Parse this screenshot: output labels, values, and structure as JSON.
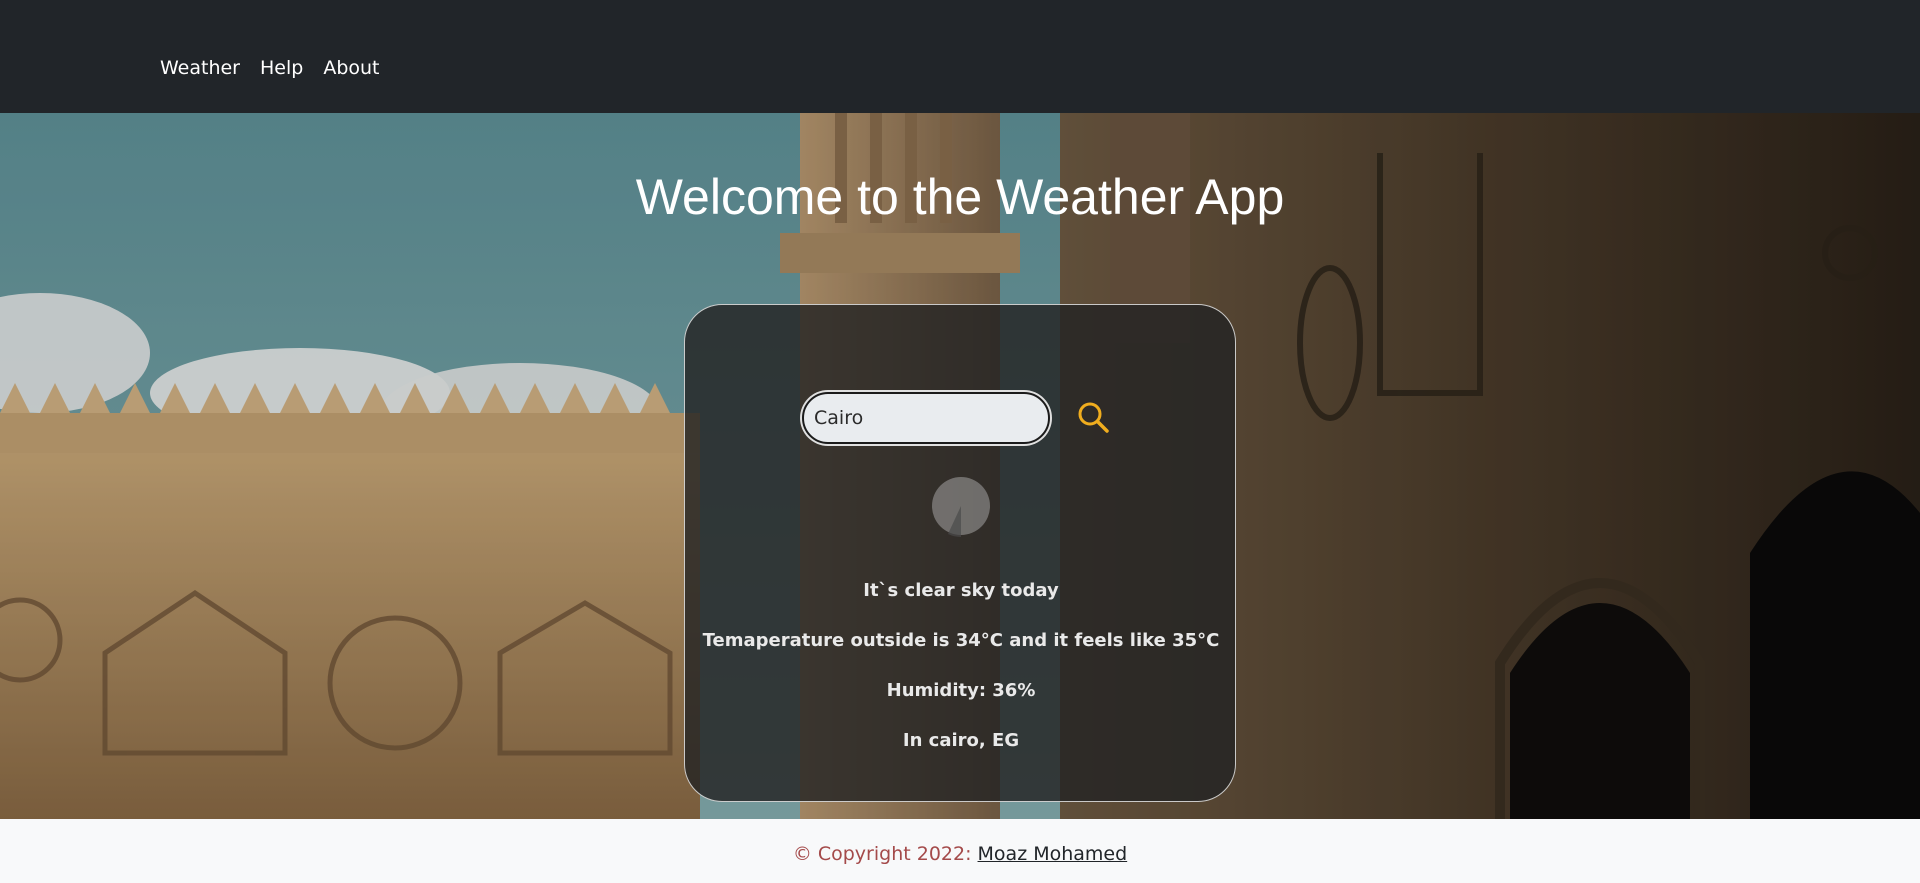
{
  "nav": {
    "items": [
      {
        "label": "Weather"
      },
      {
        "label": "Help"
      },
      {
        "label": "About"
      }
    ]
  },
  "hero": {
    "title": "Welcome to the Weather App"
  },
  "search": {
    "value": "Cairo",
    "button_icon": "search-icon"
  },
  "weather": {
    "icon": "weather-cloud-icon",
    "description": "It`s clear sky today",
    "temperature": "Temaperature outside is 34°C and it feels like 35°C",
    "humidity": "Humidity: 36%",
    "location": "In cairo, EG"
  },
  "footer": {
    "copyright": "© Copyright 2022: ",
    "author": "Moaz Mohamed"
  },
  "colors": {
    "navbar": "#212529",
    "accent": "#f0ad1e",
    "footer_bg": "#f8f9fa",
    "footer_text": "#a44a4a"
  }
}
